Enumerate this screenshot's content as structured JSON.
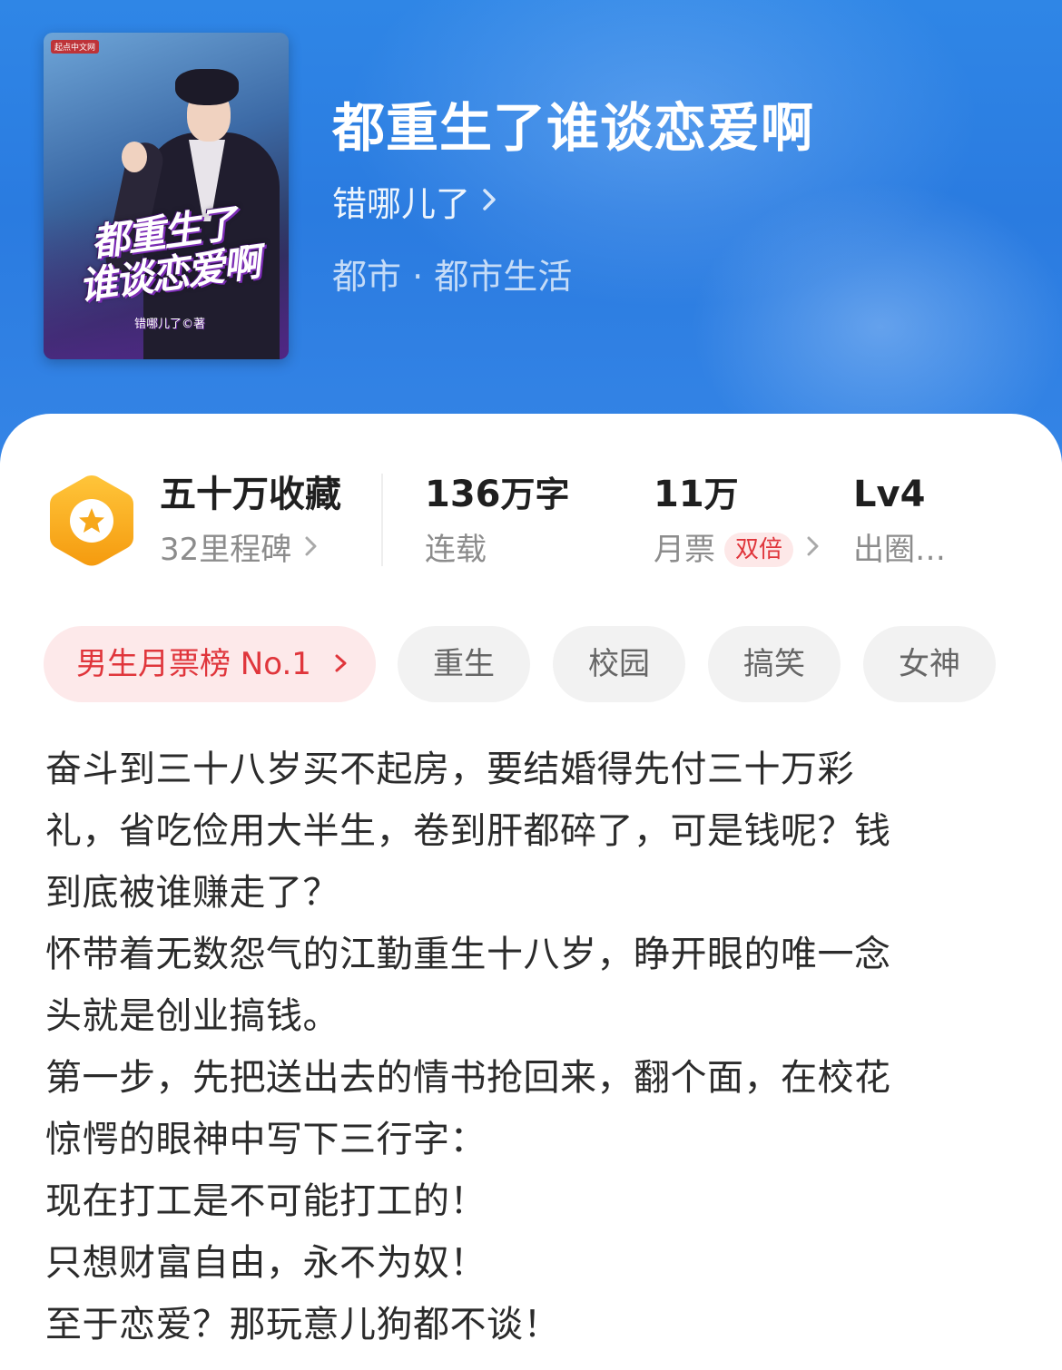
{
  "book": {
    "title": "都重生了谁谈恋爱啊",
    "author": "错哪儿了",
    "genre": "都市 · 都市生活",
    "cover": {
      "title_line1": "都重生了",
      "title_line2": "谁谈恋爱啊",
      "author_credit": "错哪儿了©著",
      "publisher": "起点中文网"
    }
  },
  "stats": {
    "favorites": {
      "value": "五十万收藏",
      "sub": "32里程碑"
    },
    "words": {
      "number": "136",
      "unit": "万字",
      "sub": "连载"
    },
    "monthly": {
      "number": "11",
      "unit": "万",
      "sub": "月票",
      "tag": "双倍"
    },
    "level": {
      "value": "Lv4",
      "sub": "出圈…"
    }
  },
  "tags": {
    "rank": "男生月票榜 No.1",
    "items": [
      "重生",
      "校园",
      "搞笑",
      "女神"
    ]
  },
  "description": [
    "奋斗到三十八岁买不起房，要结婚得先付三十万彩",
    "礼，省吃俭用大半生，卷到肝都碎了，可是钱呢？钱",
    "到底被谁赚走了？",
    "怀带着无数怨气的江勤重生十八岁，睁开眼的唯一念",
    "头就是创业搞钱。",
    "第一步，先把送出去的情书抢回来，翻个面，在校花",
    "惊愕的眼神中写下三行字：",
    "现在打工是不可能打工的！",
    "只想财富自由，永不为奴！",
    "至于恋爱？那玩意儿狗都不谈！"
  ],
  "icons": {
    "chevron": "chevron-right-icon",
    "badge": "star-hexagon-icon"
  },
  "colors": {
    "header": "#2a7be0",
    "accent_red": "#e0363c",
    "badge_orange": "#f7a81b"
  }
}
